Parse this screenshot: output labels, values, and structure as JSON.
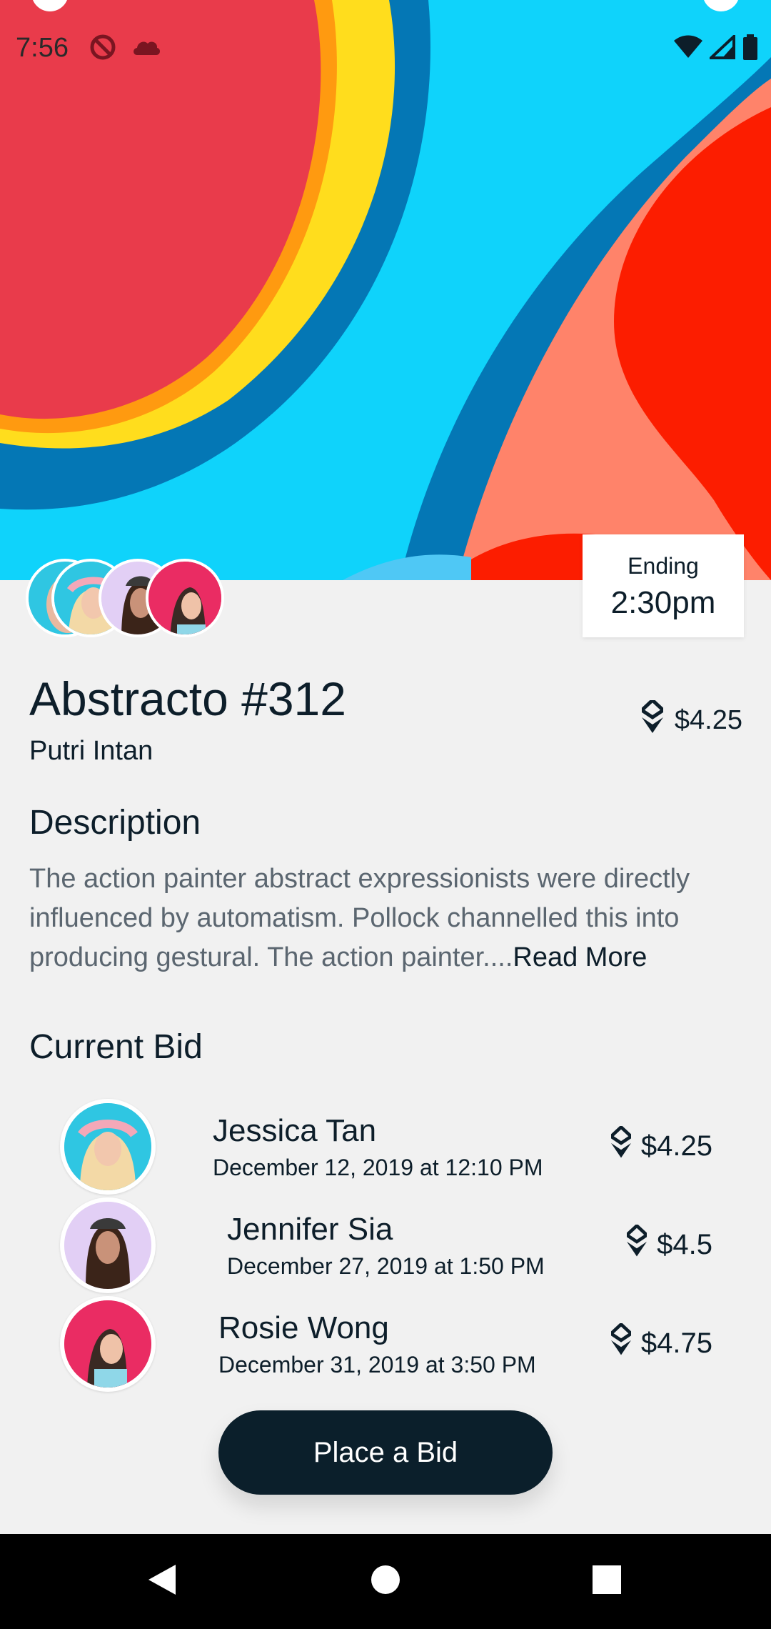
{
  "status_bar": {
    "time": "7:56",
    "left_icons": [
      "do-not-disturb-icon",
      "cloud-icon"
    ],
    "right_icons": [
      "wifi-icon",
      "signal-icon",
      "battery-icon"
    ]
  },
  "hero": {
    "colors": [
      "#e93b4b",
      "#ffdd1d",
      "#0fd3fb",
      "#0477b5",
      "#ff836a",
      "#fc1d00"
    ]
  },
  "ending": {
    "label": "Ending",
    "time": "2:30pm"
  },
  "artwork": {
    "title": "Abstracto #312",
    "artist": "Putri Intan",
    "price": "$4.25",
    "price_icon": "ethereum-icon"
  },
  "description": {
    "heading": "Description",
    "text": "The action painter abstract expressionists were directly influenced by automatism. Pollock channelled this into producing gestural. The action painter....",
    "read_more": "Read More"
  },
  "current_bid": {
    "heading": "Current Bid",
    "bids": [
      {
        "name": "Jessica Tan",
        "date": "December 12, 2019 at 12:10 PM",
        "amount": "$4.25",
        "avatar_bg": "#2fc6e2"
      },
      {
        "name": "Jennifer Sia",
        "date": "December 27, 2019 at 1:50 PM",
        "amount": "$4.5",
        "avatar_bg": "#e2cff5"
      },
      {
        "name": "Rosie Wong",
        "date": "December 31, 2019 at 3:50 PM",
        "amount": "$4.75",
        "avatar_bg": "#ea2c63"
      }
    ]
  },
  "cta": {
    "label": "Place a Bid"
  },
  "nav": {
    "buttons": [
      "back-icon",
      "home-icon",
      "recents-icon"
    ]
  }
}
